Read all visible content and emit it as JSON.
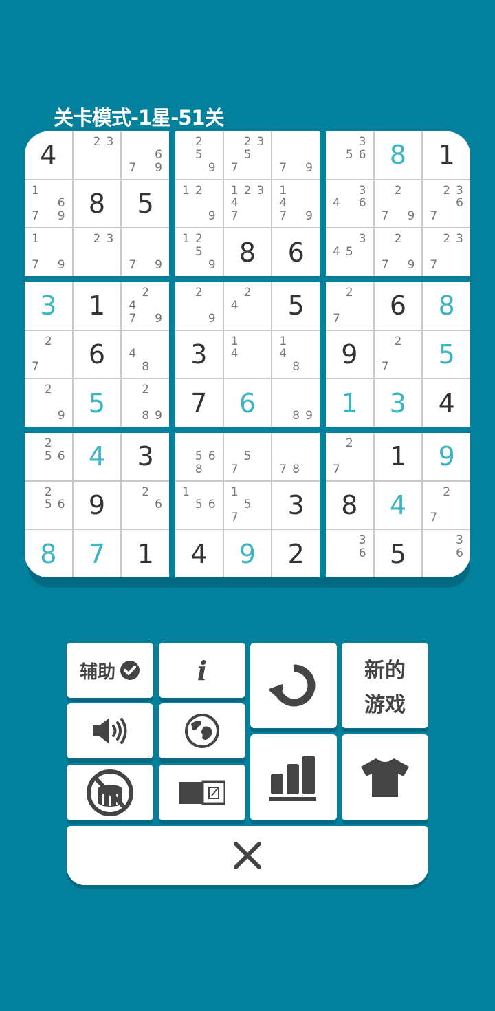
{
  "title": "关卡模式-1星-51关",
  "buttons": {
    "assist": "辅助",
    "info": "i",
    "new_game_line1": "新的",
    "new_game_line2": "游戏"
  },
  "grid": [
    [
      {
        "v": 4,
        "t": "given"
      },
      {
        "n": [
          2,
          3
        ]
      },
      {
        "n": [
          6,
          7,
          9
        ]
      },
      {
        "n": [
          2,
          5,
          9
        ]
      },
      {
        "n": [
          2,
          3,
          5,
          7
        ]
      },
      {
        "n": [
          7,
          9
        ]
      },
      {
        "n": [
          3,
          5,
          6
        ]
      },
      {
        "v": 8,
        "t": "entry"
      },
      {
        "v": 1,
        "t": "given"
      }
    ],
    [
      {
        "n": [
          1,
          6,
          7,
          9
        ]
      },
      {
        "v": 8,
        "t": "given"
      },
      {
        "v": 5,
        "t": "given"
      },
      {
        "n": [
          1,
          2,
          9
        ]
      },
      {
        "n": [
          1,
          2,
          3,
          4,
          7
        ]
      },
      {
        "n": [
          1,
          4,
          7,
          9
        ]
      },
      {
        "n": [
          3,
          4,
          6
        ]
      },
      {
        "n": [
          2,
          7,
          9
        ]
      },
      {
        "n": [
          2,
          3,
          6,
          7
        ]
      }
    ],
    [
      {
        "n": [
          1,
          7,
          9
        ]
      },
      {
        "n": [
          2,
          3
        ]
      },
      {
        "n": [
          7,
          9
        ]
      },
      {
        "n": [
          1,
          2,
          5,
          9
        ]
      },
      {
        "v": 8,
        "t": "given"
      },
      {
        "v": 6,
        "t": "given"
      },
      {
        "n": [
          3,
          4,
          5
        ]
      },
      {
        "n": [
          2,
          7,
          9
        ]
      },
      {
        "n": [
          2,
          3,
          7
        ]
      }
    ],
    [
      {
        "v": 3,
        "t": "entry"
      },
      {
        "v": 1,
        "t": "given"
      },
      {
        "n": [
          2,
          4,
          7,
          9
        ]
      },
      {
        "n": [
          2,
          9
        ]
      },
      {
        "n": [
          2,
          4
        ]
      },
      {
        "v": 5,
        "t": "given"
      },
      {
        "n": [
          2,
          7
        ]
      },
      {
        "v": 6,
        "t": "given"
      },
      {
        "v": 8,
        "t": "entry"
      }
    ],
    [
      {
        "n": [
          2,
          7
        ]
      },
      {
        "v": 6,
        "t": "given"
      },
      {
        "n": [
          4,
          8
        ]
      },
      {
        "v": 3,
        "t": "given"
      },
      {
        "n": [
          1,
          4
        ]
      },
      {
        "n": [
          1,
          4,
          8
        ]
      },
      {
        "v": 9,
        "t": "given"
      },
      {
        "n": [
          2,
          7
        ]
      },
      {
        "v": 5,
        "t": "entry"
      }
    ],
    [
      {
        "n": [
          2,
          9
        ]
      },
      {
        "v": 5,
        "t": "entry"
      },
      {
        "n": [
          2,
          8,
          9
        ]
      },
      {
        "v": 7,
        "t": "given"
      },
      {
        "v": 6,
        "t": "entry"
      },
      {
        "n": [
          8,
          9
        ]
      },
      {
        "v": 1,
        "t": "entry"
      },
      {
        "v": 3,
        "t": "entry"
      },
      {
        "v": 4,
        "t": "given"
      }
    ],
    [
      {
        "n": [
          2,
          5,
          6
        ]
      },
      {
        "v": 4,
        "t": "entry"
      },
      {
        "v": 3,
        "t": "given"
      },
      {
        "n": [
          5,
          6,
          8
        ]
      },
      {
        "n": [
          5,
          7
        ]
      },
      {
        "n": [
          7,
          8
        ]
      },
      {
        "n": [
          2,
          7
        ]
      },
      {
        "v": 1,
        "t": "given"
      },
      {
        "v": 9,
        "t": "entry"
      }
    ],
    [
      {
        "n": [
          2,
          5,
          6
        ]
      },
      {
        "v": 9,
        "t": "given"
      },
      {
        "n": [
          2,
          6
        ]
      },
      {
        "n": [
          1,
          5,
          6
        ]
      },
      {
        "n": [
          1,
          5,
          7
        ]
      },
      {
        "v": 3,
        "t": "given"
      },
      {
        "v": 8,
        "t": "given"
      },
      {
        "v": 4,
        "t": "entry"
      },
      {
        "n": [
          2,
          7
        ]
      }
    ],
    [
      {
        "v": 8,
        "t": "entry"
      },
      {
        "v": 7,
        "t": "entry"
      },
      {
        "v": 1,
        "t": "given"
      },
      {
        "v": 4,
        "t": "given"
      },
      {
        "v": 9,
        "t": "entry"
      },
      {
        "v": 2,
        "t": "given"
      },
      {
        "n": [
          3,
          6
        ]
      },
      {
        "v": 5,
        "t": "given"
      },
      {
        "n": [
          3,
          6
        ]
      }
    ]
  ],
  "colors": {
    "background": "#02809c",
    "entry": "#3cb6c3",
    "given": "#333333",
    "note": "#777777"
  }
}
